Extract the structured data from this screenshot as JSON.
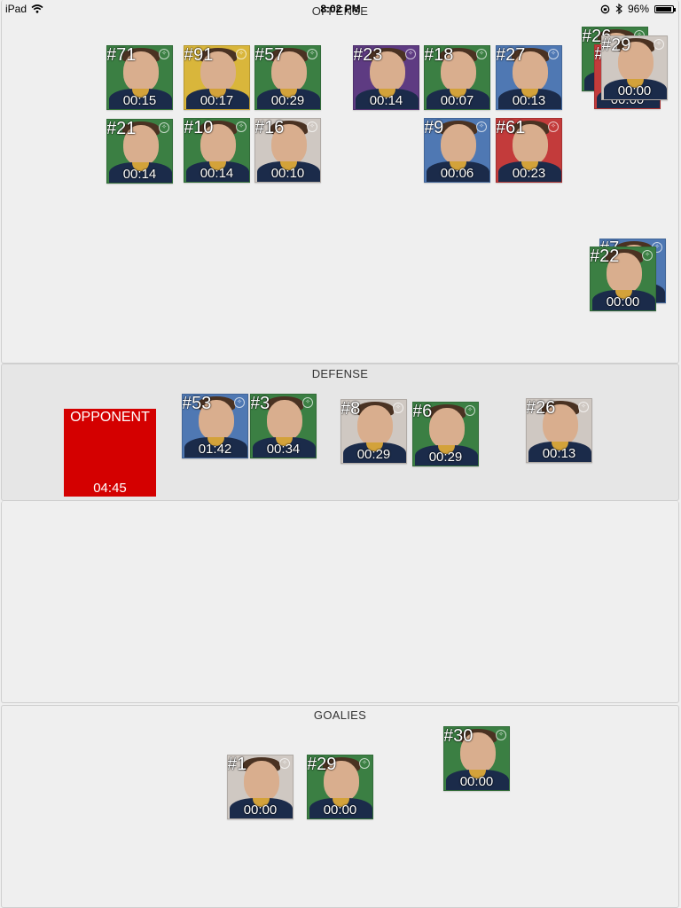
{
  "statusbar": {
    "device": "iPad",
    "time": "8:02 PM",
    "battery": "96%",
    "battery_level": 0.96
  },
  "sections": {
    "offense": "OFFENSE",
    "defense": "DEFENSE",
    "goalies": "GOALIES"
  },
  "colors": {
    "green": "#3b7f43",
    "yellow": "#d9b63b",
    "purple": "#5e3b82",
    "blue": "#4f78b3",
    "red": "#c33b3b",
    "grey": "#cfc8c2",
    "opponent": "#d40000"
  },
  "offense": [
    {
      "number": "#71",
      "time": "00:15",
      "color": "green"
    },
    {
      "number": "#91",
      "time": "00:17",
      "color": "yellow"
    },
    {
      "number": "#57",
      "time": "00:29",
      "color": "green"
    },
    {
      "number": "#23",
      "time": "00:14",
      "color": "purple"
    },
    {
      "number": "#18",
      "time": "00:07",
      "color": "green"
    },
    {
      "number": "#27",
      "time": "00:13",
      "color": "blue"
    },
    {
      "number": "#21",
      "time": "00:14",
      "color": "green"
    },
    {
      "number": "#10",
      "time": "00:14",
      "color": "green"
    },
    {
      "number": "#16",
      "time": "00:10",
      "color": "grey"
    },
    {
      "number": "#9",
      "time": "00:06",
      "color": "blue"
    },
    {
      "number": "#61",
      "time": "00:23",
      "color": "red"
    },
    {
      "number": "#26",
      "time": "00:00",
      "color": "green"
    },
    {
      "number": "#",
      "time": "00:00",
      "color": "red"
    },
    {
      "number": "#29",
      "time": "00:00",
      "color": "grey"
    },
    {
      "number": "#7",
      "time": "00:00",
      "color": "blue"
    },
    {
      "number": "#22",
      "time": "00:00",
      "color": "green"
    }
  ],
  "defense": [
    {
      "number": "#53",
      "time": "01:42",
      "color": "blue"
    },
    {
      "number": "#3",
      "time": "00:34",
      "color": "green"
    },
    {
      "number": "#8",
      "time": "00:29",
      "color": "grey"
    },
    {
      "number": "#6",
      "time": "00:29",
      "color": "green"
    },
    {
      "number": "#26",
      "time": "00:13",
      "color": "grey"
    }
  ],
  "opponent": {
    "label": "OPPONENT",
    "time": "04:45"
  },
  "goalies": [
    {
      "number": "#1",
      "time": "00:00",
      "color": "grey"
    },
    {
      "number": "#29",
      "time": "00:00",
      "color": "green"
    },
    {
      "number": "#30",
      "time": "00:00",
      "color": "green"
    }
  ]
}
